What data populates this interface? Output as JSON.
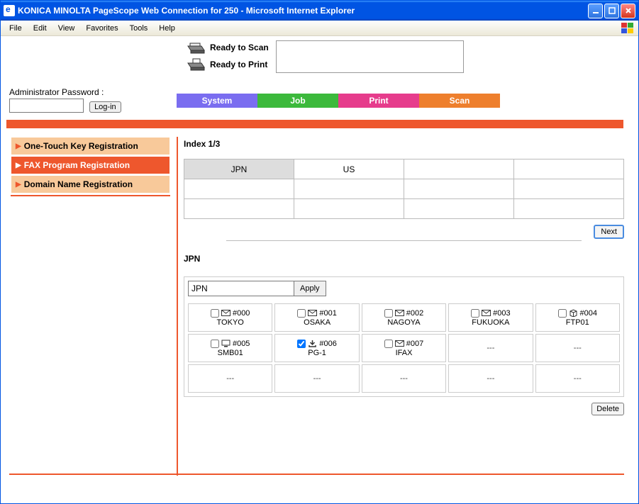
{
  "window": {
    "title": "KONICA MINOLTA PageScope Web Connection for 250 - Microsoft Internet Explorer"
  },
  "menu": {
    "file": "File",
    "edit": "Edit",
    "view": "View",
    "favorites": "Favorites",
    "tools": "Tools",
    "help": "Help"
  },
  "status": {
    "scan": "Ready to Scan",
    "print": "Ready to Print"
  },
  "login": {
    "label": "Administrator Password :",
    "button": "Log-in"
  },
  "tabs": {
    "system": "System",
    "job": "Job",
    "print": "Print",
    "scan": "Scan"
  },
  "sidebar": {
    "items": [
      {
        "label": "One-Touch Key Registration"
      },
      {
        "label": "FAX Program Registration"
      },
      {
        "label": "Domain Name Registration"
      }
    ]
  },
  "index": {
    "title": "Index 1/3",
    "rows": [
      [
        "JPN",
        "US",
        "",
        ""
      ],
      [
        "",
        "",
        "",
        ""
      ],
      [
        "",
        "",
        "",
        ""
      ]
    ],
    "next": "Next"
  },
  "group": {
    "selected": "JPN",
    "input_value": "JPN",
    "apply": "Apply",
    "delete": "Delete",
    "destinations": [
      {
        "num": "#000",
        "name": "TOKYO",
        "icon": "mail",
        "checked": false
      },
      {
        "num": "#001",
        "name": "OSAKA",
        "icon": "mail",
        "checked": false
      },
      {
        "num": "#002",
        "name": "NAGOYA",
        "icon": "mail",
        "checked": false
      },
      {
        "num": "#003",
        "name": "FUKUOKA",
        "icon": "mail",
        "checked": false
      },
      {
        "num": "#004",
        "name": "FTP01",
        "icon": "box",
        "checked": false
      },
      {
        "num": "#005",
        "name": "SMB01",
        "icon": "pc",
        "checked": false
      },
      {
        "num": "#006",
        "name": "PG-1",
        "icon": "download",
        "checked": true
      },
      {
        "num": "#007",
        "name": "IFAX",
        "icon": "mail",
        "checked": false
      },
      {
        "empty": true
      },
      {
        "empty": true
      },
      {
        "empty": true
      },
      {
        "empty": true
      },
      {
        "empty": true
      },
      {
        "empty": true
      },
      {
        "empty": true
      }
    ],
    "empty_label": "---"
  }
}
